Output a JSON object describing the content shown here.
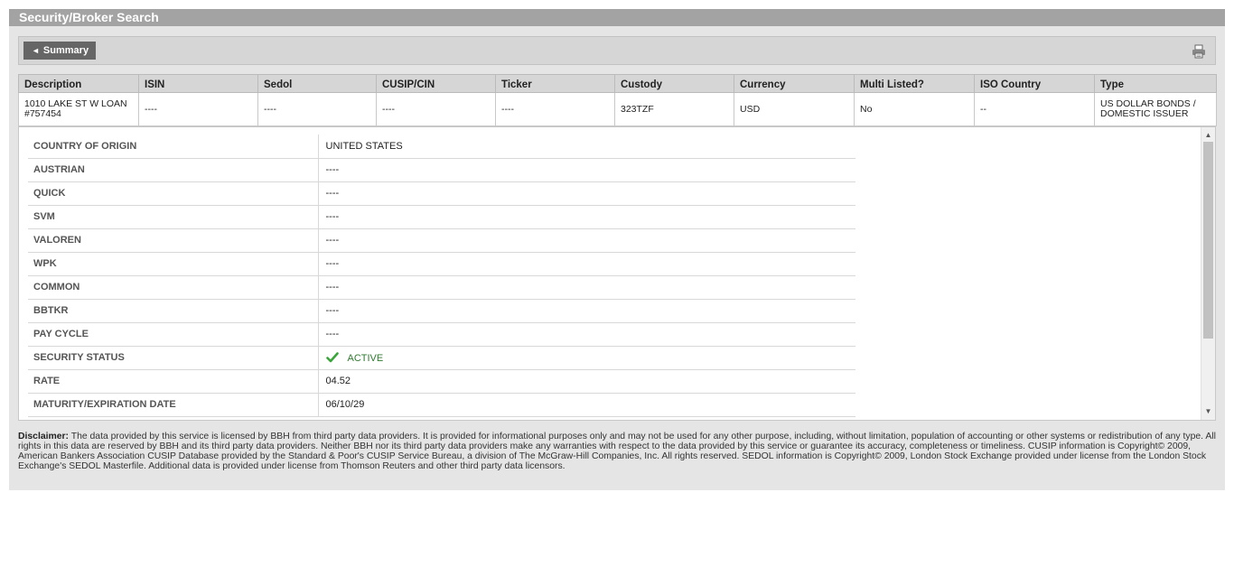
{
  "panel": {
    "title": "Security/Broker Search"
  },
  "toolbar": {
    "summary_label": "Summary",
    "summary_arrow": "◄",
    "print_icon": "printer-icon"
  },
  "grid": {
    "headers": [
      "Description",
      "ISIN",
      "Sedol",
      "CUSIP/CIN",
      "Ticker",
      "Custody",
      "Currency",
      "Multi Listed?",
      "ISO Country",
      "Type"
    ],
    "row": {
      "description_line1": "1010 LAKE ST W LOAN",
      "description_line2": "#757454",
      "isin": "----",
      "sedol": "----",
      "cusip": "----",
      "ticker": "----",
      "custody": "323TZF",
      "currency": "USD",
      "multi_listed": "No",
      "iso_country": "--",
      "type_line1": "US DOLLAR BONDS /",
      "type_line2": "DOMESTIC ISSUER"
    }
  },
  "details": [
    {
      "label": "COUNTRY OF ORIGIN",
      "value": "UNITED STATES"
    },
    {
      "label": "AUSTRIAN",
      "value": "----"
    },
    {
      "label": "QUICK",
      "value": "----"
    },
    {
      "label": "SVM",
      "value": "----"
    },
    {
      "label": "VALOREN",
      "value": "----"
    },
    {
      "label": "WPK",
      "value": "----"
    },
    {
      "label": "COMMON",
      "value": "----"
    },
    {
      "label": "BBTKR",
      "value": "----"
    },
    {
      "label": "PAY CYCLE",
      "value": "----"
    },
    {
      "label": "SECURITY STATUS",
      "value": "ACTIVE"
    },
    {
      "label": "RATE",
      "value": "04.52"
    },
    {
      "label": "MATURITY/EXPIRATION DATE",
      "value": "06/10/29"
    }
  ],
  "colors": {
    "status_ok": "#2f7a2f",
    "check": "#3aa53a"
  },
  "disclaimer": {
    "label": "Disclaimer:",
    "text": " The data provided by this service is licensed by BBH from third party data providers. It is provided for informational purposes only and may not be used for any other purpose, including, without limitation, population of accounting or other systems or redistribution of any type. All rights in this data are reserved by BBH and its third party data providers. Neither BBH nor its third party data providers make any warranties with respect to the data provided by this service or guarantee its accuracy, completeness or timeliness. CUSIP information is Copyright© 2009, American Bankers Association CUSIP Database provided by the Standard & Poor's CUSIP Service Bureau, a division of The McGraw-Hill Companies, Inc. All rights reserved. SEDOL information is Copyright© 2009, London Stock Exchange provided under license from the London Stock Exchange's SEDOL Masterfile. Additional data is provided under license from Thomson Reuters and other third party data licensors."
  }
}
